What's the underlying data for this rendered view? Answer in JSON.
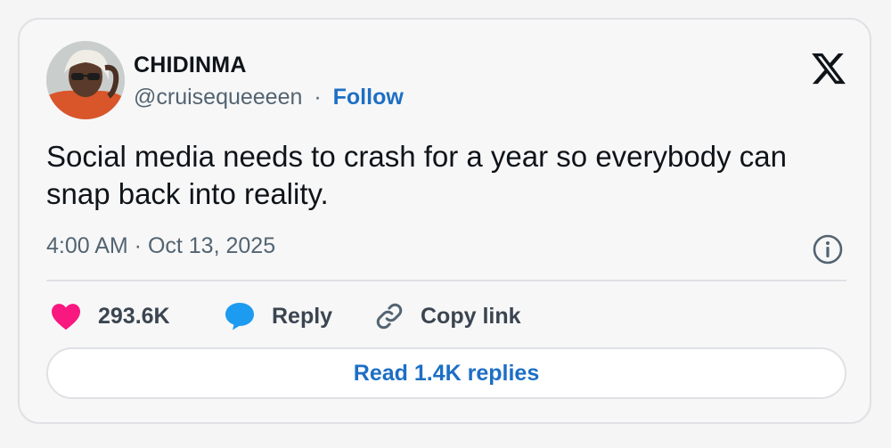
{
  "author": {
    "name": "CHIDINMA",
    "handle": "@cruisequeeeen",
    "separator": "·",
    "follow_label": "Follow"
  },
  "platform_icon": "x-logo-icon",
  "tweet": {
    "text": "Social media needs to crash for a year so everybody can snap back into reality.",
    "timestamp": "4:00 AM · Oct 13, 2025"
  },
  "actions": {
    "likes": "293.6K",
    "reply_label": "Reply",
    "copy_link_label": "Copy link"
  },
  "read_replies_label": "Read 1.4K replies",
  "colors": {
    "like": "#f91880",
    "reply": "#1d9bf0",
    "link_blue": "#1d6fc4",
    "muted": "#536471",
    "border": "#dfe1e4"
  }
}
